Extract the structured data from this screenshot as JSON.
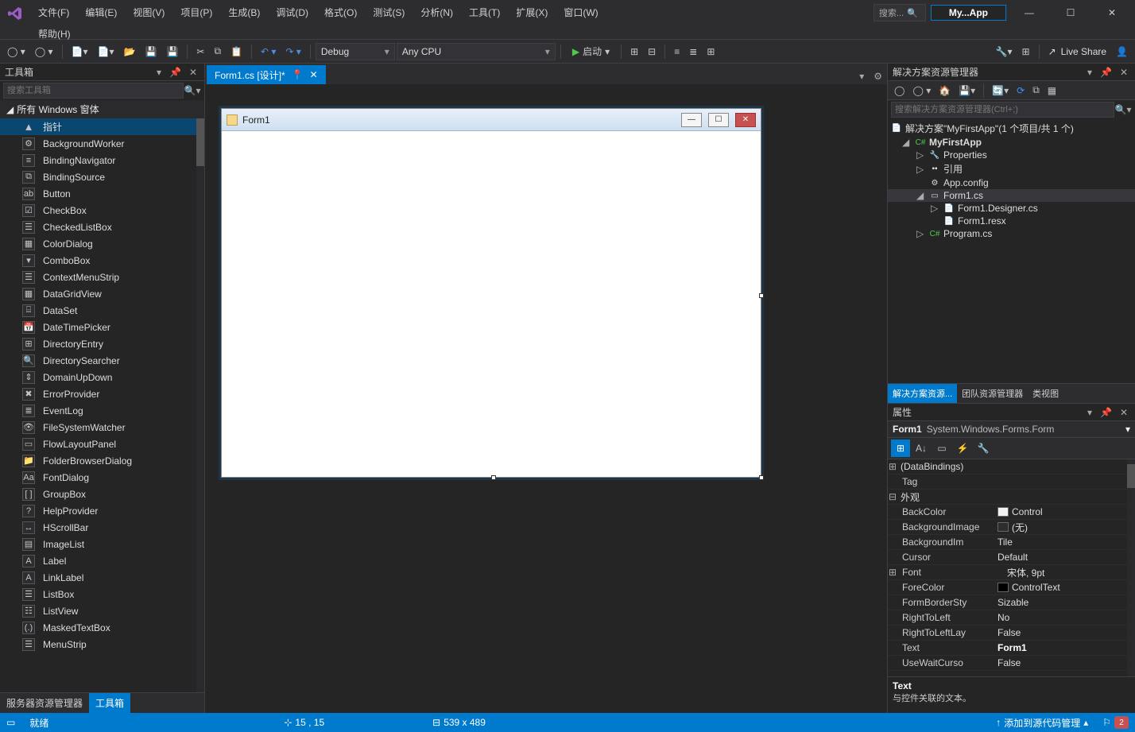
{
  "menu": {
    "file": "文件(F)",
    "edit": "编辑(E)",
    "view": "视图(V)",
    "project": "项目(P)",
    "build": "生成(B)",
    "debug": "调试(D)",
    "format": "格式(O)",
    "test": "测试(S)",
    "analyze": "分析(N)",
    "tools": "工具(T)",
    "extensions": "扩展(X)",
    "window": "窗口(W)",
    "help": "帮助(H)"
  },
  "title_search_placeholder": "搜索...",
  "app_name": "My...App",
  "toolbar": {
    "config_label": "Debug",
    "platform_label": "Any CPU",
    "start_label": "启动",
    "live_share": "Live Share"
  },
  "toolbox": {
    "title": "工具箱",
    "search_placeholder": "搜索工具箱",
    "group_title": "所有 Windows 窗体",
    "items": [
      {
        "label": "指针",
        "icon": "▲"
      },
      {
        "label": "BackgroundWorker",
        "icon": "⚙"
      },
      {
        "label": "BindingNavigator",
        "icon": "≡"
      },
      {
        "label": "BindingSource",
        "icon": "⧉"
      },
      {
        "label": "Button",
        "icon": "ab"
      },
      {
        "label": "CheckBox",
        "icon": "☑"
      },
      {
        "label": "CheckedListBox",
        "icon": "☰"
      },
      {
        "label": "ColorDialog",
        "icon": "▦"
      },
      {
        "label": "ComboBox",
        "icon": "▾"
      },
      {
        "label": "ContextMenuStrip",
        "icon": "☰"
      },
      {
        "label": "DataGridView",
        "icon": "▦"
      },
      {
        "label": "DataSet",
        "icon": "⌸"
      },
      {
        "label": "DateTimePicker",
        "icon": "📅"
      },
      {
        "label": "DirectoryEntry",
        "icon": "⊞"
      },
      {
        "label": "DirectorySearcher",
        "icon": "🔍"
      },
      {
        "label": "DomainUpDown",
        "icon": "⇕"
      },
      {
        "label": "ErrorProvider",
        "icon": "✖"
      },
      {
        "label": "EventLog",
        "icon": "≣"
      },
      {
        "label": "FileSystemWatcher",
        "icon": "👁"
      },
      {
        "label": "FlowLayoutPanel",
        "icon": "▭"
      },
      {
        "label": "FolderBrowserDialog",
        "icon": "📁"
      },
      {
        "label": "FontDialog",
        "icon": "Aa"
      },
      {
        "label": "GroupBox",
        "icon": "[ ]"
      },
      {
        "label": "HelpProvider",
        "icon": "?"
      },
      {
        "label": "HScrollBar",
        "icon": "↔"
      },
      {
        "label": "ImageList",
        "icon": "▤"
      },
      {
        "label": "Label",
        "icon": "A"
      },
      {
        "label": "LinkLabel",
        "icon": "A"
      },
      {
        "label": "ListBox",
        "icon": "☰"
      },
      {
        "label": "ListView",
        "icon": "☷"
      },
      {
        "label": "MaskedTextBox",
        "icon": "(.)"
      },
      {
        "label": "MenuStrip",
        "icon": "☰"
      }
    ],
    "tabs": {
      "server": "服务器资源管理器",
      "toolbox": "工具箱"
    }
  },
  "document": {
    "tab_label": "Form1.cs [设计]*",
    "form_title": "Form1"
  },
  "solution": {
    "title": "解决方案资源管理器",
    "search_placeholder": "搜索解决方案资源管理器(Ctrl+;)",
    "root": "解决方案\"MyFirstApp\"(1 个项目/共 1 个)",
    "project": "MyFirstApp",
    "properties": "Properties",
    "references": "引用",
    "appconfig": "App.config",
    "form1cs": "Form1.cs",
    "designer": "Form1.Designer.cs",
    "resx": "Form1.resx",
    "program": "Program.cs",
    "tabs": {
      "soln": "解决方案资源...",
      "team": "团队资源管理器",
      "classview": "类视图"
    }
  },
  "properties": {
    "title": "属性",
    "object_name": "Form1",
    "object_type": "System.Windows.Forms.Form",
    "categories": {
      "databindings": "(DataBindings)",
      "appearance": "外观"
    },
    "rows": [
      {
        "name": "Tag",
        "value": ""
      },
      {
        "name": "BackColor",
        "value": "Control",
        "swatch": "#f0f0f0"
      },
      {
        "name": "BackgroundImage",
        "value": "(无)",
        "swatch": "#2d2d30"
      },
      {
        "name": "BackgroundImageLayout",
        "value": "Tile",
        "short": "BackgroundIm"
      },
      {
        "name": "Cursor",
        "value": "Default"
      },
      {
        "name": "Font",
        "value": "宋体, 9pt",
        "expand": true
      },
      {
        "name": "ForeColor",
        "value": "ControlText",
        "swatch": "#000"
      },
      {
        "name": "FormBorderStyle",
        "value": "Sizable",
        "short": "FormBorderSty"
      },
      {
        "name": "RightToLeft",
        "value": "No"
      },
      {
        "name": "RightToLeftLayout",
        "value": "False",
        "short": "RightToLeftLay"
      },
      {
        "name": "Text",
        "value": "Form1",
        "bold": true
      },
      {
        "name": "UseWaitCursor",
        "value": "False",
        "short": "UseWaitCurso"
      }
    ],
    "desc_name": "Text",
    "desc_text": "与控件关联的文本。"
  },
  "statusbar": {
    "ready": "就绪",
    "pos": "15 , 15",
    "size": "539 x 489",
    "source_control": "添加到源代码管理",
    "notif_count": "2"
  }
}
